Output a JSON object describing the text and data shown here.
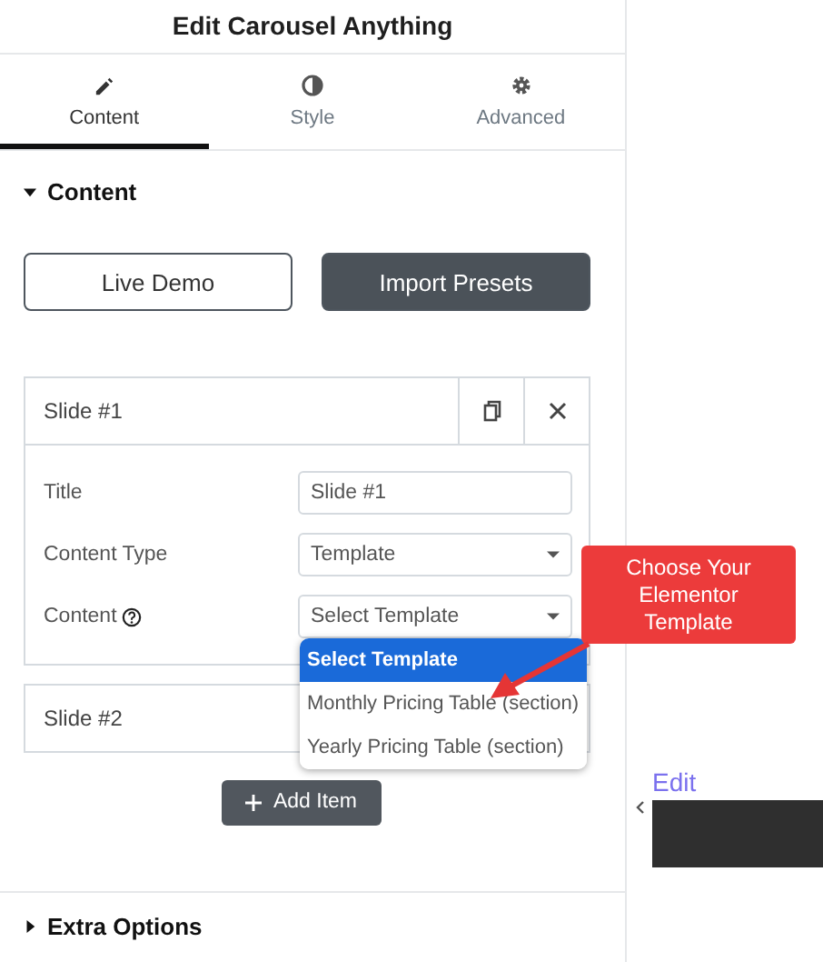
{
  "panel": {
    "title": "Edit Carousel Anything"
  },
  "tabs": [
    {
      "label": "Content",
      "kind": "pencil",
      "selected": true
    },
    {
      "label": "Style",
      "kind": "contrast",
      "selected": false
    },
    {
      "label": "Advanced",
      "kind": "gear",
      "selected": false
    }
  ],
  "section": {
    "title": "Content",
    "expanded": true
  },
  "buttons": [
    {
      "label": "Live Demo",
      "kind": "outline"
    },
    {
      "label": "Import Presets",
      "kind": "filled"
    }
  ],
  "slides": [
    {
      "title": "Slide #1",
      "expanded": true,
      "fields": [
        {
          "label": "Title",
          "kind": "text",
          "value": "Slide #1"
        },
        {
          "label": "Content Type",
          "kind": "select",
          "value": "Template"
        },
        {
          "label": "Content",
          "kind": "select",
          "help": true,
          "value": "Select Template",
          "open": true,
          "options": [
            {
              "label": "Select Template",
              "selected": true
            },
            {
              "label": "Monthly Pricing Table (section)",
              "selected": false
            },
            {
              "label": "Yearly Pricing Table (section)",
              "selected": false
            }
          ]
        }
      ]
    },
    {
      "title": "Slide #2",
      "expanded": false
    }
  ],
  "add_button": {
    "label": "Add Item"
  },
  "collapsed_section": {
    "title": "Extra Options",
    "expanded": false
  },
  "callout": {
    "text": "Choose Your Elementor Template"
  },
  "preview": {
    "link": "Edit"
  }
}
